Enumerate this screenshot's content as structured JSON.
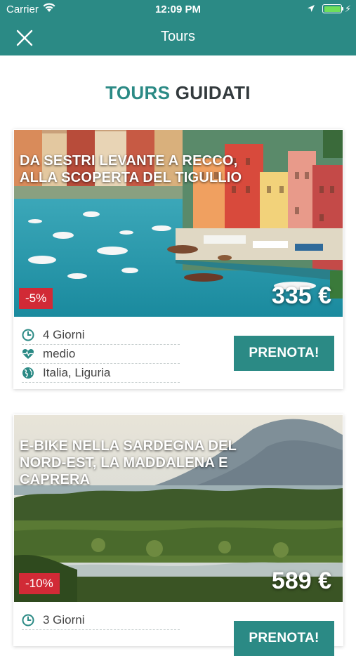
{
  "status_bar": {
    "carrier": "Carrier",
    "time": "12:09 PM"
  },
  "nav": {
    "title": "Tours"
  },
  "heading": {
    "part1": "TOURS",
    "part2": "GUIDATI"
  },
  "tours": [
    {
      "title": "DA SESTRI LEVANTE A RECCO, ALLA SCOPERTA DEL TIGULLIO",
      "discount": "-5%",
      "price": "335 €",
      "duration": "4 Giorni",
      "difficulty": "medio",
      "location": "Italia, Liguria",
      "book_label": "PRENOTA!"
    },
    {
      "title": "E-BIKE NELLA SARDEGNA DEL NORD-EST, LA MADDALENA E CAPRERA",
      "discount": "-10%",
      "price": "589 €",
      "duration": "3 Giorni",
      "book_label": "PRENOTA!"
    }
  ],
  "colors": {
    "accent": "#2b8a85",
    "discount": "#d12a36",
    "heading_dark": "#333a3d"
  }
}
